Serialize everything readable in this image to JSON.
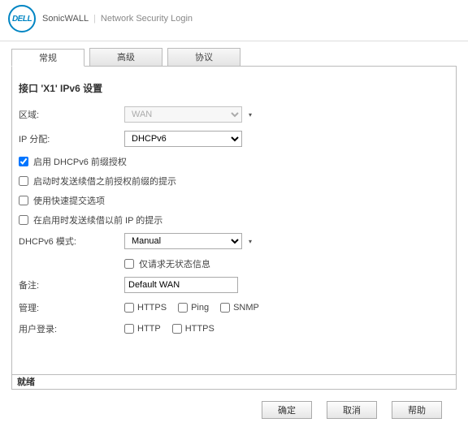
{
  "header": {
    "logo_text": "DELL",
    "brand": "SonicWALL",
    "subtitle": "Network Security Login"
  },
  "tabs": [
    {
      "label": "常规",
      "active": true
    },
    {
      "label": "高级",
      "active": false
    },
    {
      "label": "协议",
      "active": false
    }
  ],
  "page": {
    "title": "接口 'X1' IPv6 设置"
  },
  "form": {
    "zone_label": "区域:",
    "zone_value": "WAN",
    "ip_assign_label": "IP 分配:",
    "ip_assign_value": "DHCPv6",
    "chk_enable_prefix": {
      "label": "启用 DHCPv6 前缀授权",
      "checked": true
    },
    "chk_send_hints": {
      "label": "启动时发送续借之前授权前缀的提示",
      "checked": false
    },
    "chk_rapid_commit": {
      "label": "使用快速提交选项",
      "checked": false
    },
    "chk_send_prev_ip": {
      "label": "在启用时发送续借以前 IP 的提示",
      "checked": false
    },
    "dhcpv6_mode_label": "DHCPv6 模式:",
    "dhcpv6_mode_value": "Manual",
    "chk_stateless": {
      "label": "仅请求无状态信息",
      "checked": false
    },
    "note_label": "备注:",
    "note_value": "Default WAN",
    "mgmt_label": "管理:",
    "mgmt_https": "HTTPS",
    "mgmt_ping": "Ping",
    "mgmt_snmp": "SNMP",
    "userlogin_label": "用户登录:",
    "userlogin_http": "HTTP",
    "userlogin_https": "HTTPS"
  },
  "status": "就绪",
  "buttons": {
    "ok": "确定",
    "cancel": "取消",
    "help": "帮助"
  }
}
